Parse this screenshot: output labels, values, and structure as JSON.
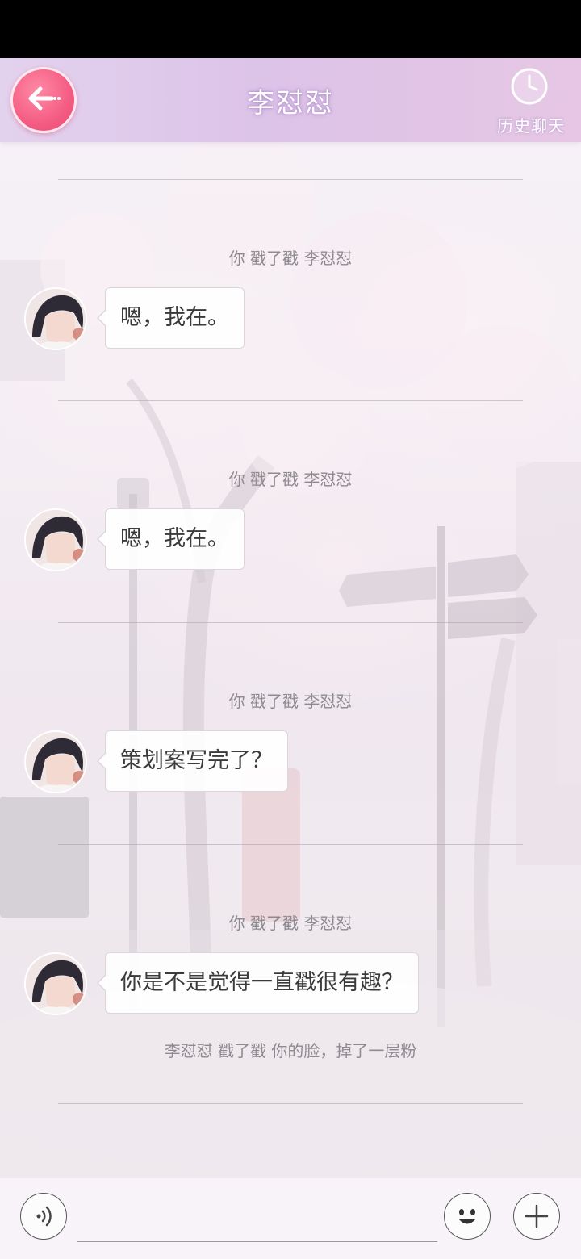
{
  "header": {
    "title": "李怼怼",
    "history_label": "历史聊天"
  },
  "messages": [
    {
      "system": "你 戳了戳 李怼怼",
      "bubble": "嗯，我在。"
    },
    {
      "system": "你 戳了戳 李怼怼",
      "bubble": "嗯，我在。"
    },
    {
      "system": "你 戳了戳 李怼怼",
      "bubble": "策划案写完了？"
    },
    {
      "system": "你 戳了戳 李怼怼",
      "bubble": "你是不是觉得一直戳很有趣？"
    }
  ],
  "last_system_note": "李怼怼 戳了戳 你的脸，掉了一层粉",
  "input": {
    "value": "",
    "placeholder": ""
  },
  "icons": {
    "back": "back-arrow-icon",
    "history": "clock-icon",
    "voice": "voice-icon",
    "emoji": "emoji-icon",
    "add": "plus-icon"
  },
  "colors": {
    "accent": "#f45c83",
    "header_bg": "#dcc3e8"
  }
}
